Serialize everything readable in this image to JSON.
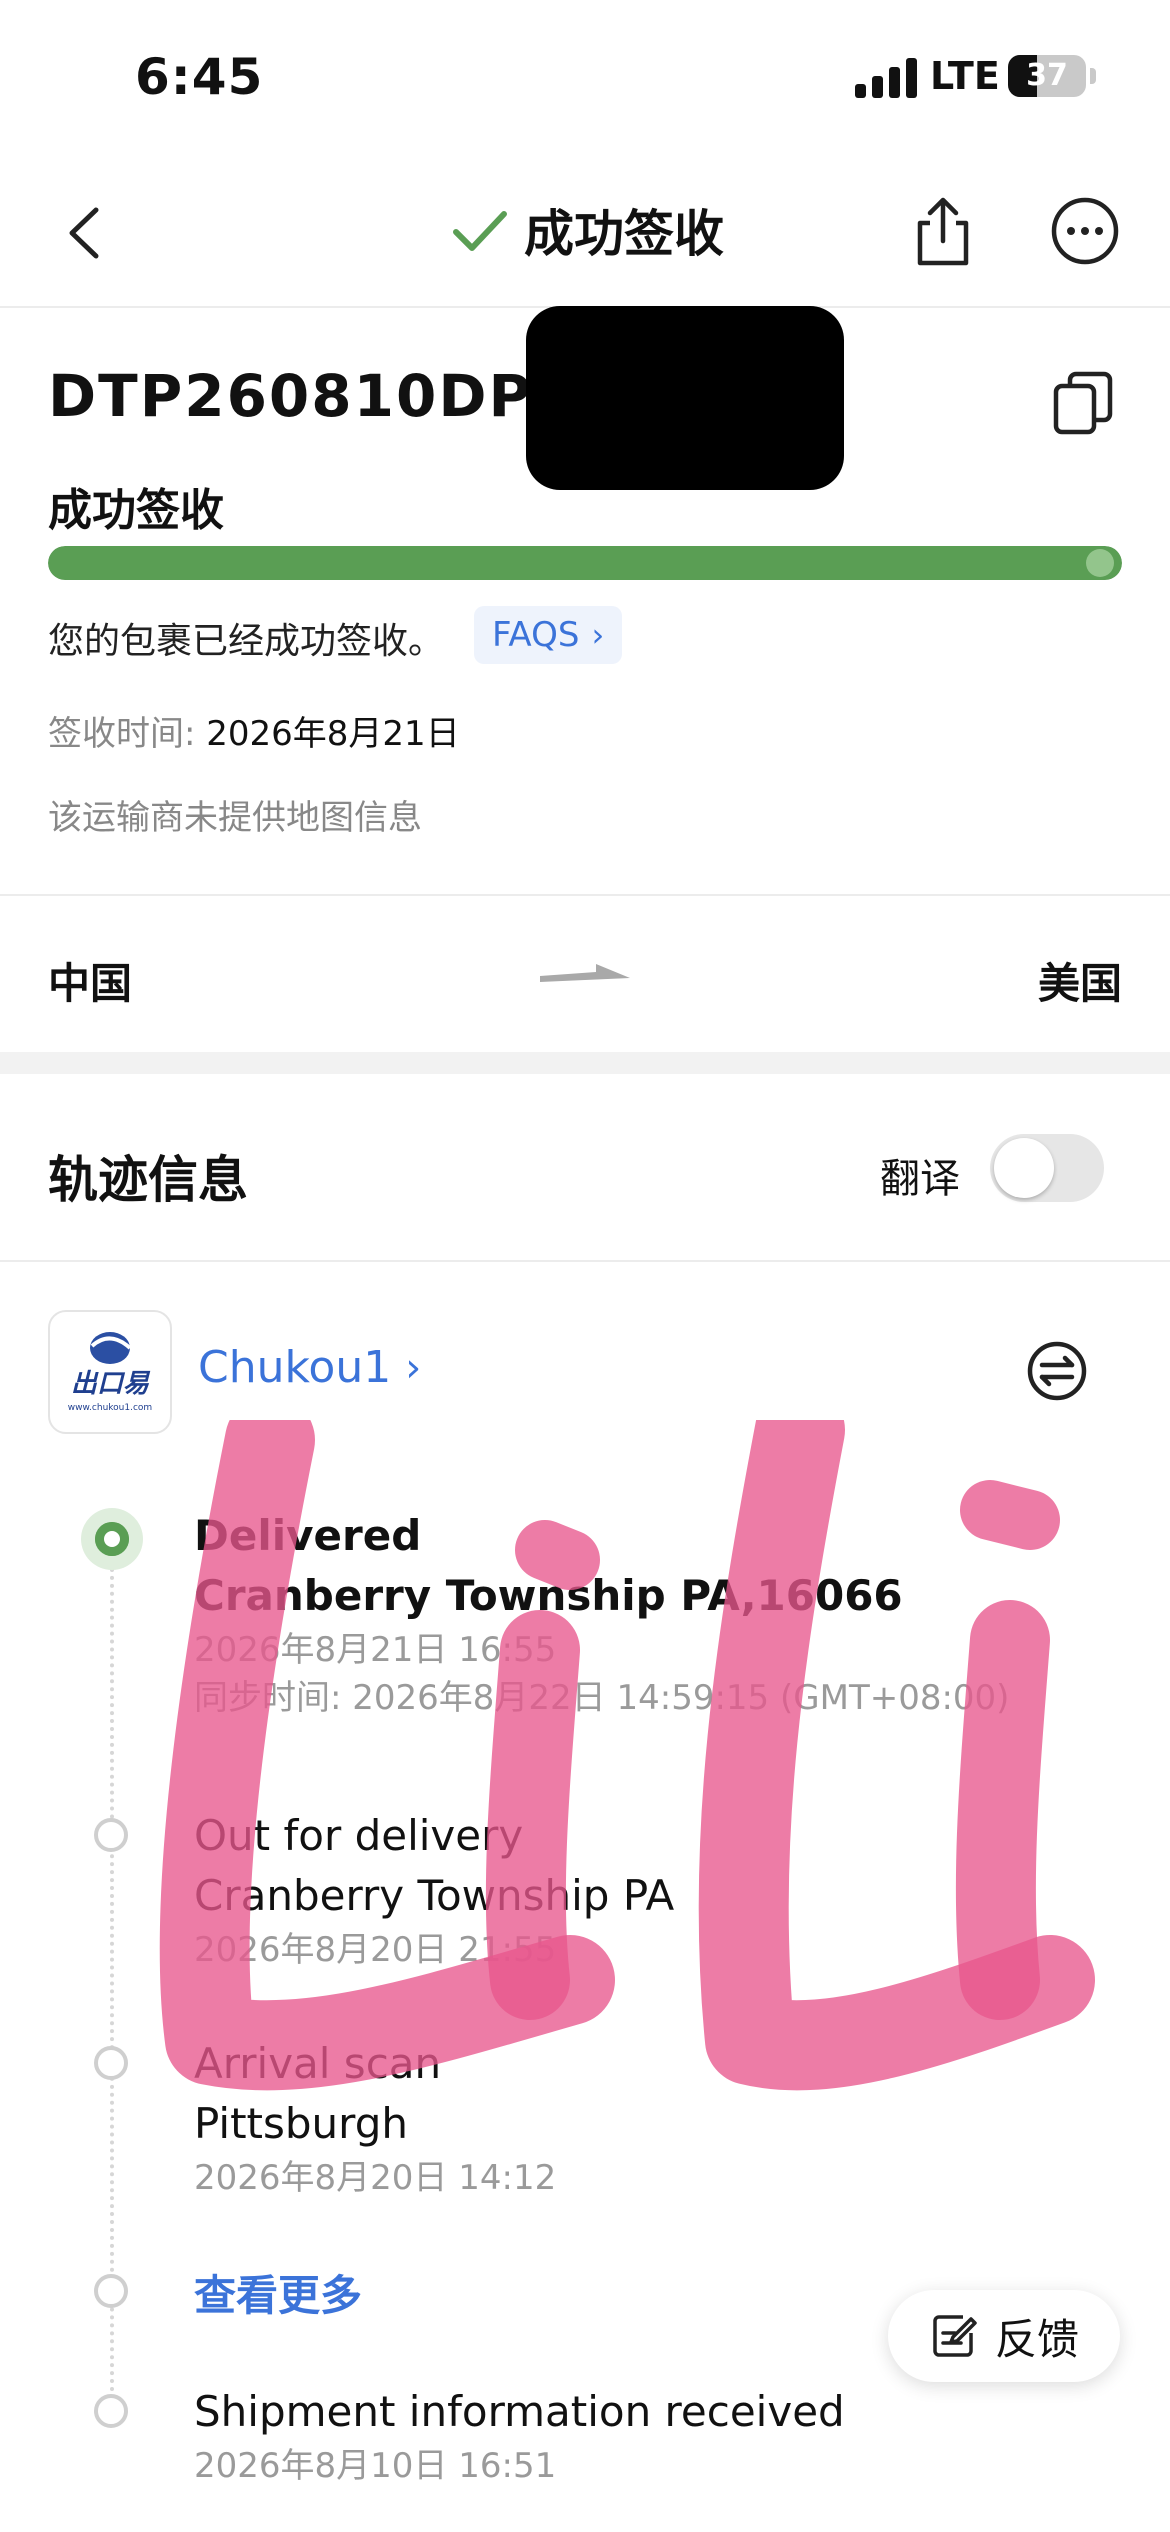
{
  "status_bar": {
    "time": "6:45",
    "network": "LTE",
    "battery": "37",
    "battery_level_percent": 37
  },
  "header": {
    "title": "成功签收",
    "icons": [
      "back-icon",
      "checkmark-icon",
      "share-icon",
      "more-icon"
    ]
  },
  "package": {
    "tracking_number": "DTP260810DP2",
    "status_label": "成功签收",
    "progress_percent": 100,
    "message": "您的包裹已经成功签收。",
    "faqs_label": "FAQS",
    "sign_time_label": "签收时间: ",
    "sign_time_value": "2026年8月21日",
    "no_map_note": "该运输商未提供地图信息"
  },
  "route": {
    "origin": "中国",
    "destination": "美国"
  },
  "tracking": {
    "title": "轨迹信息",
    "translate_label": "翻译",
    "translate_on": false,
    "carrier": {
      "name": "Chukou1",
      "logo_text": "出口易",
      "logo_url_text": "www.chukou1.com"
    },
    "events": [
      {
        "status": "Delivered",
        "location": "Cranberry Township PA,16066",
        "time": "2026年8月21日 16:55",
        "sync_time": "同步时间: 2026年8月22日 14:59:15 (GMT+08:00)"
      },
      {
        "status": "Out for delivery",
        "location": "Cranberry Township PA",
        "time": "2026年8月20日 21:55"
      },
      {
        "status": "Arrival scan",
        "location": "Pittsburgh",
        "time": "2026年8月20日 14:12"
      },
      {
        "status": "Shipment information received",
        "time": "2026年8月10日 16:51"
      }
    ],
    "see_more": "查看更多"
  },
  "feedback": {
    "label": "反馈"
  },
  "colors": {
    "accent_green": "#5a9e54",
    "link_blue": "#3b73d9",
    "watermark_pink": "#e8578d"
  }
}
